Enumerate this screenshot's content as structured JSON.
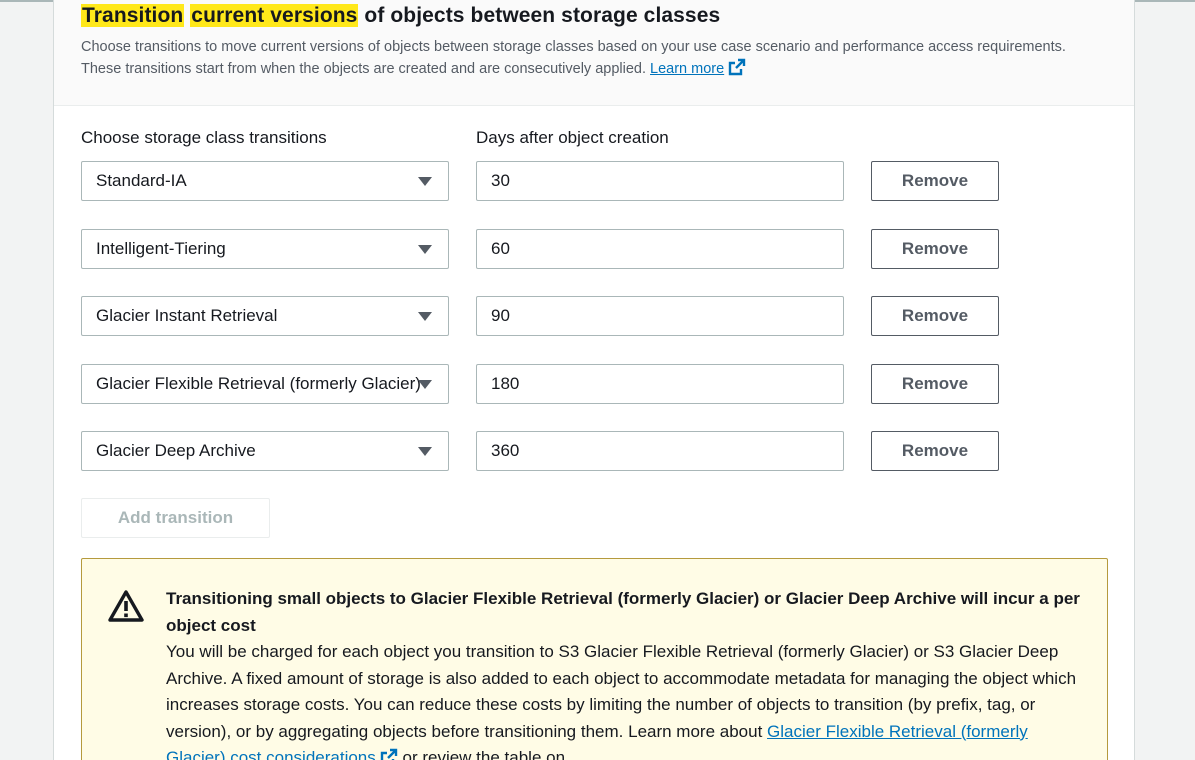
{
  "section": {
    "title_hl1": "Transition",
    "title_hl2": "current versions",
    "title_rest": " of objects between storage classes",
    "description": "Choose transitions to move current versions of objects between storage classes based on your use case scenario and performance access requirements. These transitions start from when the objects are created and are consecutively applied.",
    "learn_more": "Learn more"
  },
  "labels": {
    "storage_class": "Choose storage class transitions",
    "days": "Days after object creation"
  },
  "transitions": [
    {
      "storage_class": "Standard-IA",
      "days": "30",
      "remove": "Remove"
    },
    {
      "storage_class": "Intelligent-Tiering",
      "days": "60",
      "remove": "Remove"
    },
    {
      "storage_class": "Glacier Instant Retrieval",
      "days": "90",
      "remove": "Remove"
    },
    {
      "storage_class": "Glacier Flexible Retrieval (formerly Glacier)",
      "days": "180",
      "remove": "Remove"
    },
    {
      "storage_class": "Glacier Deep Archive",
      "days": "360",
      "remove": "Remove"
    }
  ],
  "add_transition": "Add transition",
  "alert": {
    "title": "Transitioning small objects to Glacier Flexible Retrieval (formerly Glacier) or Glacier Deep Archive will incur a per object cost",
    "body": "You will be charged for each object you transition to S3 Glacier Flexible Retrieval (formerly Glacier) or S3 Glacier Deep Archive. A fixed amount of storage is also added to each object to accommodate metadata for managing the object which increases storage costs. You can reduce these costs by limiting the number of objects to transition (by prefix, tag, or version), or by aggregating objects before transitioning them.",
    "learn_prefix": "Learn more about ",
    "learn_link": "Glacier Flexible Retrieval (formerly Glacier) cost considerations",
    "learn_suffix": " or review the table on"
  },
  "colors": {
    "highlight": "#ffe81a",
    "link": "#0073bb",
    "alert_bg": "#fffce6"
  }
}
